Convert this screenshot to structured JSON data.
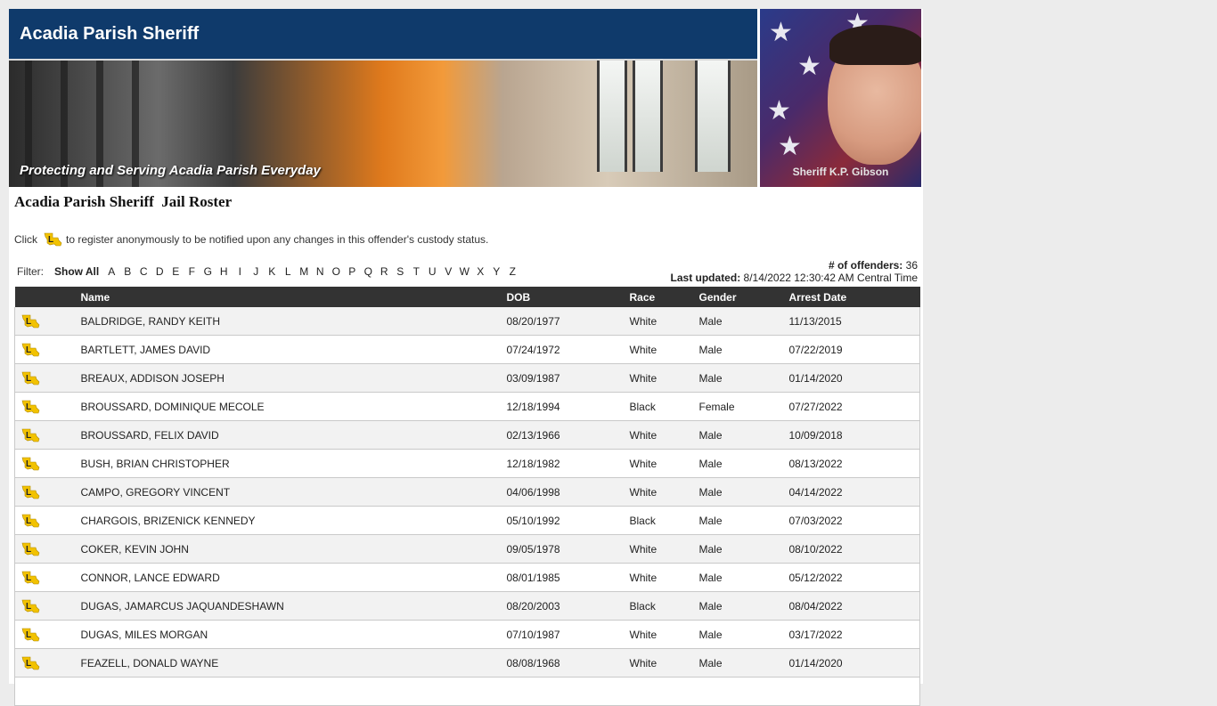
{
  "header": {
    "site_title": "Acadia Parish Sheriff",
    "tagline": "Protecting and Serving Acadia Parish Everyday",
    "sheriff_name": "Sheriff K.P. Gibson"
  },
  "page": {
    "roster_title": "Acadia Parish Sheriff  Jail Roster",
    "notice_before": "Click",
    "notice_after": "to register anonymously to be notified upon any changes in this offender's custody status.",
    "notify_icon": "louisiana-notify-icon"
  },
  "filter": {
    "label": "Filter:",
    "show_all": "Show All",
    "letters": [
      "A",
      "B",
      "C",
      "D",
      "E",
      "F",
      "G",
      "H",
      "I",
      "J",
      "K",
      "L",
      "M",
      "N",
      "O",
      "P",
      "Q",
      "R",
      "S",
      "T",
      "U",
      "V",
      "W",
      "X",
      "Y",
      "Z"
    ]
  },
  "stats": {
    "offenders_label": "# of offenders:",
    "offenders_value": "36",
    "updated_label": "Last updated:",
    "updated_value": "8/14/2022 12:30:42 AM Central Time"
  },
  "table": {
    "columns": [
      "",
      "Name",
      "DOB",
      "Race",
      "Gender",
      "Arrest Date"
    ],
    "rows": [
      [
        "BALDRIDGE, RANDY KEITH",
        "08/20/1977",
        "White",
        "Male",
        "11/13/2015"
      ],
      [
        "BARTLETT, JAMES DAVID",
        "07/24/1972",
        "White",
        "Male",
        "07/22/2019"
      ],
      [
        "BREAUX, ADDISON JOSEPH",
        "03/09/1987",
        "White",
        "Male",
        "01/14/2020"
      ],
      [
        "BROUSSARD, DOMINIQUE MECOLE",
        "12/18/1994",
        "Black",
        "Female",
        "07/27/2022"
      ],
      [
        "BROUSSARD, FELIX DAVID",
        "02/13/1966",
        "White",
        "Male",
        "10/09/2018"
      ],
      [
        "BUSH, BRIAN CHRISTOPHER",
        "12/18/1982",
        "White",
        "Male",
        "08/13/2022"
      ],
      [
        "CAMPO, GREGORY VINCENT",
        "04/06/1998",
        "White",
        "Male",
        "04/14/2022"
      ],
      [
        "CHARGOIS, BRIZENICK KENNEDY",
        "05/10/1992",
        "Black",
        "Male",
        "07/03/2022"
      ],
      [
        "COKER, KEVIN JOHN",
        "09/05/1978",
        "White",
        "Male",
        "08/10/2022"
      ],
      [
        "CONNOR, LANCE EDWARD",
        "08/01/1985",
        "White",
        "Male",
        "05/12/2022"
      ],
      [
        "DUGAS, JAMARCUS JAQUANDESHAWN",
        "08/20/2003",
        "Black",
        "Male",
        "08/04/2022"
      ],
      [
        "DUGAS, MILES MORGAN",
        "07/10/1987",
        "White",
        "Male",
        "03/17/2022"
      ],
      [
        "FEAZELL, DONALD WAYNE",
        "08/08/1968",
        "White",
        "Male",
        "01/14/2020"
      ],
      [
        "",
        "",
        "",
        "",
        ""
      ]
    ]
  },
  "colors": {
    "title_bar": "#0f3a6b",
    "table_header": "#333333",
    "notify_icon_fill": "#f2c200",
    "notify_icon_letter": "#222222"
  }
}
